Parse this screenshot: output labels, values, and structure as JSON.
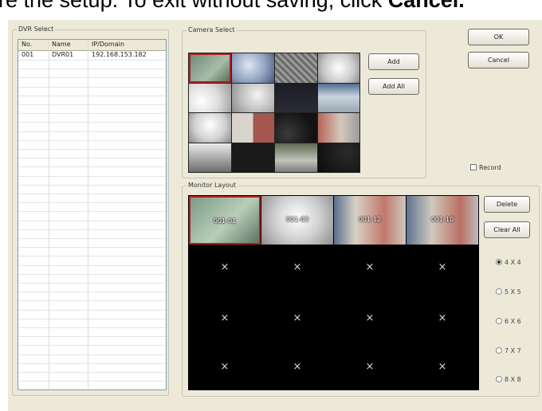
{
  "caption": {
    "prefix": "re the setup. To exit without saving, click ",
    "emphasis": "Cancel."
  },
  "dvr_select": {
    "title": "DVR Select",
    "columns": [
      "No.",
      "Name",
      "IP/Domain"
    ],
    "rows": [
      {
        "no": "001",
        "name": "DVR01",
        "ip": "192.168.153.182"
      }
    ]
  },
  "camera_select": {
    "title": "Camera Select",
    "add_label": "Add",
    "add_all_label": "Add All"
  },
  "dialog_buttons": {
    "ok_label": "OK",
    "cancel_label": "Cancel"
  },
  "record": {
    "label": "Record",
    "checked": false
  },
  "monitor_layout": {
    "title": "Monitor Layout",
    "tiles": [
      "001-01",
      "001-03",
      "001-12",
      "001-10"
    ],
    "empty_mark": "×",
    "delete_label": "Delete",
    "clear_all_label": "Clear All",
    "layouts": [
      {
        "label": "4 X 4",
        "selected": true
      },
      {
        "label": "5 X 5",
        "selected": false
      },
      {
        "label": "6 X 6",
        "selected": false
      },
      {
        "label": "7 X 7",
        "selected": false
      },
      {
        "label": "8 X 8",
        "selected": false
      }
    ]
  },
  "colors": {
    "dialog_bg": "#ece9d8",
    "selection_border": "#b02020",
    "monitor_bg": "#000000"
  }
}
